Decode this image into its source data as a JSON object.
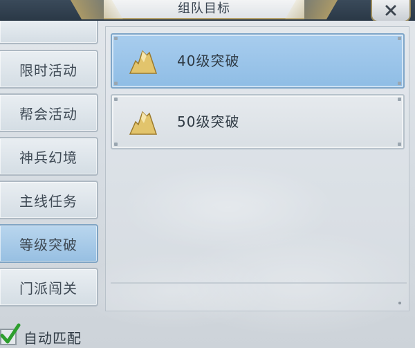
{
  "window": {
    "title": "组队目标",
    "close_icon": "close-icon"
  },
  "sidebar": {
    "items": [
      {
        "label": "限时活动",
        "active": false
      },
      {
        "label": "帮会活动",
        "active": false
      },
      {
        "label": "神兵幻境",
        "active": false
      },
      {
        "label": "主线任务",
        "active": false
      },
      {
        "label": "等级突破",
        "active": true
      },
      {
        "label": "门派闯关",
        "active": false
      }
    ]
  },
  "goals": [
    {
      "label": "40级突破",
      "selected": true,
      "icon": "mountain-icon"
    },
    {
      "label": "50级突破",
      "selected": false,
      "icon": "mountain-icon"
    }
  ],
  "footer": {
    "auto_match_label": "自动匹配",
    "auto_match_checked": true
  },
  "colors": {
    "selected_bg": "#9cc6ea",
    "panel_bg": "#dfe4e9",
    "accent_gold": "#b8a36a",
    "check_green": "#2e9e2e"
  }
}
